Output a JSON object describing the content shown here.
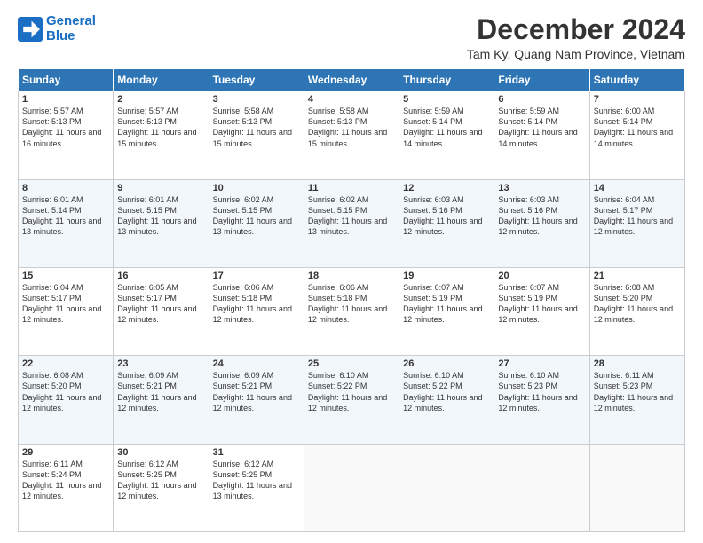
{
  "logo": {
    "line1": "General",
    "line2": "Blue"
  },
  "title": "December 2024",
  "subtitle": "Tam Ky, Quang Nam Province, Vietnam",
  "days_header": [
    "Sunday",
    "Monday",
    "Tuesday",
    "Wednesday",
    "Thursday",
    "Friday",
    "Saturday"
  ],
  "weeks": [
    [
      {
        "day": "1",
        "sunrise": "Sunrise: 5:57 AM",
        "sunset": "Sunset: 5:13 PM",
        "daylight": "Daylight: 11 hours and 16 minutes."
      },
      {
        "day": "2",
        "sunrise": "Sunrise: 5:57 AM",
        "sunset": "Sunset: 5:13 PM",
        "daylight": "Daylight: 11 hours and 15 minutes."
      },
      {
        "day": "3",
        "sunrise": "Sunrise: 5:58 AM",
        "sunset": "Sunset: 5:13 PM",
        "daylight": "Daylight: 11 hours and 15 minutes."
      },
      {
        "day": "4",
        "sunrise": "Sunrise: 5:58 AM",
        "sunset": "Sunset: 5:13 PM",
        "daylight": "Daylight: 11 hours and 15 minutes."
      },
      {
        "day": "5",
        "sunrise": "Sunrise: 5:59 AM",
        "sunset": "Sunset: 5:14 PM",
        "daylight": "Daylight: 11 hours and 14 minutes."
      },
      {
        "day": "6",
        "sunrise": "Sunrise: 5:59 AM",
        "sunset": "Sunset: 5:14 PM",
        "daylight": "Daylight: 11 hours and 14 minutes."
      },
      {
        "day": "7",
        "sunrise": "Sunrise: 6:00 AM",
        "sunset": "Sunset: 5:14 PM",
        "daylight": "Daylight: 11 hours and 14 minutes."
      }
    ],
    [
      {
        "day": "8",
        "sunrise": "Sunrise: 6:01 AM",
        "sunset": "Sunset: 5:14 PM",
        "daylight": "Daylight: 11 hours and 13 minutes."
      },
      {
        "day": "9",
        "sunrise": "Sunrise: 6:01 AM",
        "sunset": "Sunset: 5:15 PM",
        "daylight": "Daylight: 11 hours and 13 minutes."
      },
      {
        "day": "10",
        "sunrise": "Sunrise: 6:02 AM",
        "sunset": "Sunset: 5:15 PM",
        "daylight": "Daylight: 11 hours and 13 minutes."
      },
      {
        "day": "11",
        "sunrise": "Sunrise: 6:02 AM",
        "sunset": "Sunset: 5:15 PM",
        "daylight": "Daylight: 11 hours and 13 minutes."
      },
      {
        "day": "12",
        "sunrise": "Sunrise: 6:03 AM",
        "sunset": "Sunset: 5:16 PM",
        "daylight": "Daylight: 11 hours and 12 minutes."
      },
      {
        "day": "13",
        "sunrise": "Sunrise: 6:03 AM",
        "sunset": "Sunset: 5:16 PM",
        "daylight": "Daylight: 11 hours and 12 minutes."
      },
      {
        "day": "14",
        "sunrise": "Sunrise: 6:04 AM",
        "sunset": "Sunset: 5:17 PM",
        "daylight": "Daylight: 11 hours and 12 minutes."
      }
    ],
    [
      {
        "day": "15",
        "sunrise": "Sunrise: 6:04 AM",
        "sunset": "Sunset: 5:17 PM",
        "daylight": "Daylight: 11 hours and 12 minutes."
      },
      {
        "day": "16",
        "sunrise": "Sunrise: 6:05 AM",
        "sunset": "Sunset: 5:17 PM",
        "daylight": "Daylight: 11 hours and 12 minutes."
      },
      {
        "day": "17",
        "sunrise": "Sunrise: 6:06 AM",
        "sunset": "Sunset: 5:18 PM",
        "daylight": "Daylight: 11 hours and 12 minutes."
      },
      {
        "day": "18",
        "sunrise": "Sunrise: 6:06 AM",
        "sunset": "Sunset: 5:18 PM",
        "daylight": "Daylight: 11 hours and 12 minutes."
      },
      {
        "day": "19",
        "sunrise": "Sunrise: 6:07 AM",
        "sunset": "Sunset: 5:19 PM",
        "daylight": "Daylight: 11 hours and 12 minutes."
      },
      {
        "day": "20",
        "sunrise": "Sunrise: 6:07 AM",
        "sunset": "Sunset: 5:19 PM",
        "daylight": "Daylight: 11 hours and 12 minutes."
      },
      {
        "day": "21",
        "sunrise": "Sunrise: 6:08 AM",
        "sunset": "Sunset: 5:20 PM",
        "daylight": "Daylight: 11 hours and 12 minutes."
      }
    ],
    [
      {
        "day": "22",
        "sunrise": "Sunrise: 6:08 AM",
        "sunset": "Sunset: 5:20 PM",
        "daylight": "Daylight: 11 hours and 12 minutes."
      },
      {
        "day": "23",
        "sunrise": "Sunrise: 6:09 AM",
        "sunset": "Sunset: 5:21 PM",
        "daylight": "Daylight: 11 hours and 12 minutes."
      },
      {
        "day": "24",
        "sunrise": "Sunrise: 6:09 AM",
        "sunset": "Sunset: 5:21 PM",
        "daylight": "Daylight: 11 hours and 12 minutes."
      },
      {
        "day": "25",
        "sunrise": "Sunrise: 6:10 AM",
        "sunset": "Sunset: 5:22 PM",
        "daylight": "Daylight: 11 hours and 12 minutes."
      },
      {
        "day": "26",
        "sunrise": "Sunrise: 6:10 AM",
        "sunset": "Sunset: 5:22 PM",
        "daylight": "Daylight: 11 hours and 12 minutes."
      },
      {
        "day": "27",
        "sunrise": "Sunrise: 6:10 AM",
        "sunset": "Sunset: 5:23 PM",
        "daylight": "Daylight: 11 hours and 12 minutes."
      },
      {
        "day": "28",
        "sunrise": "Sunrise: 6:11 AM",
        "sunset": "Sunset: 5:23 PM",
        "daylight": "Daylight: 11 hours and 12 minutes."
      }
    ],
    [
      {
        "day": "29",
        "sunrise": "Sunrise: 6:11 AM",
        "sunset": "Sunset: 5:24 PM",
        "daylight": "Daylight: 11 hours and 12 minutes."
      },
      {
        "day": "30",
        "sunrise": "Sunrise: 6:12 AM",
        "sunset": "Sunset: 5:25 PM",
        "daylight": "Daylight: 11 hours and 12 minutes."
      },
      {
        "day": "31",
        "sunrise": "Sunrise: 6:12 AM",
        "sunset": "Sunset: 5:25 PM",
        "daylight": "Daylight: 11 hours and 13 minutes."
      },
      null,
      null,
      null,
      null
    ]
  ]
}
